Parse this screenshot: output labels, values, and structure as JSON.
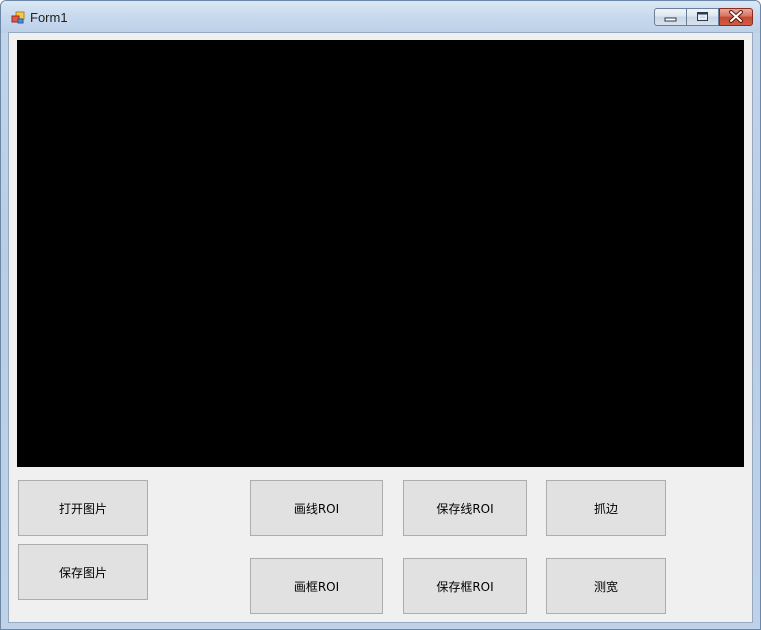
{
  "window": {
    "title": "Form1",
    "icon": "windows-form-icon"
  },
  "caption_buttons": {
    "minimize_icon": "minimize-icon",
    "maximize_icon": "maximize-icon",
    "close_icon": "close-icon"
  },
  "picture_box": {
    "background": "#000000"
  },
  "buttons": {
    "open_image": "打开图片",
    "save_image": "保存图片",
    "draw_line_roi": "画线ROI",
    "draw_rect_roi": "画框ROI",
    "save_line_roi": "保存线ROI",
    "save_rect_roi": "保存框ROI",
    "edge_detect": "抓边",
    "measure_width": "测宽"
  }
}
